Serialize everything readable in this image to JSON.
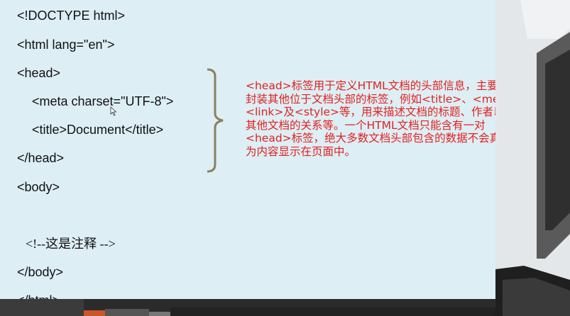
{
  "code_lines": [
    "<!DOCTYPE html>",
    "<html lang=\"en\">",
    "<head>",
    "<meta charset=\"UTF-8\">",
    "<title>Document</title>",
    "</head>",
    "<body>",
    "<!--这是注释 -->",
    "</body>",
    "</html>"
  ],
  "annotation": {
    "line1": "<head>标签用于定义HTML文档的头部信息，主要用来",
    "line2": "封装其他位于文档头部的标签，例如<title>、<meta>、",
    "line3": "<link>及<style>等，用来描述文档的标题、作者以及和",
    "line4": "其他文档的关系等。一个HTML文档只能含有一对",
    "line5": "<head>标签，绝大多数文档头部包含的数据不会真正作",
    "line6": "为内容显示在页面中。"
  },
  "colors": {
    "slide_bg": "#ddeef5",
    "annotation_text": "#e0221e",
    "brace": "#8b8060",
    "side_dark": "#2f2f2f",
    "accent_orange": "#c8572a"
  }
}
